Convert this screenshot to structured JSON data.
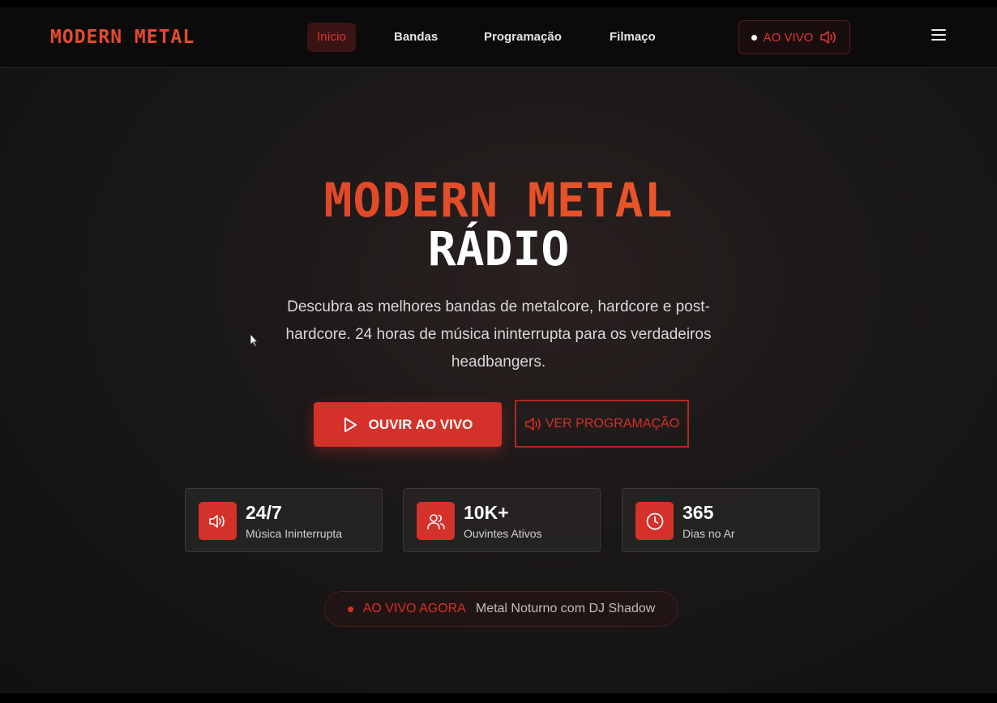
{
  "nav": {
    "logo": "MODERN METAL",
    "links": [
      "Início",
      "Bandas",
      "Programação",
      "Filmaço"
    ],
    "live_label": "AO VIVO"
  },
  "hero": {
    "title_line1": "MODERN METAL",
    "title_line2": "RÁDIO",
    "description": "Descubra as melhores bandas de metalcore, hardcore e post-hardcore. 24 horas de música ininterrupta para os verdadeiros headbangers.",
    "primary_button": "OUVIR AO VIVO",
    "secondary_button": "VER PROGRAMAÇÃO"
  },
  "stats": [
    {
      "value": "24/7",
      "label": "Música Ininterrupta",
      "icon": "speaker-icon"
    },
    {
      "value": "10K+",
      "label": "Ouvintes Ativos",
      "icon": "users-icon"
    },
    {
      "value": "365",
      "label": "Dias no Ar",
      "icon": "clock-icon"
    }
  ],
  "now_playing": {
    "label": "AO VIVO AGORA",
    "show": "Metal Noturno com DJ Shadow"
  },
  "colors": {
    "accent": "#d4312a",
    "logo": "#e54b2b",
    "background": "#1a1717"
  }
}
